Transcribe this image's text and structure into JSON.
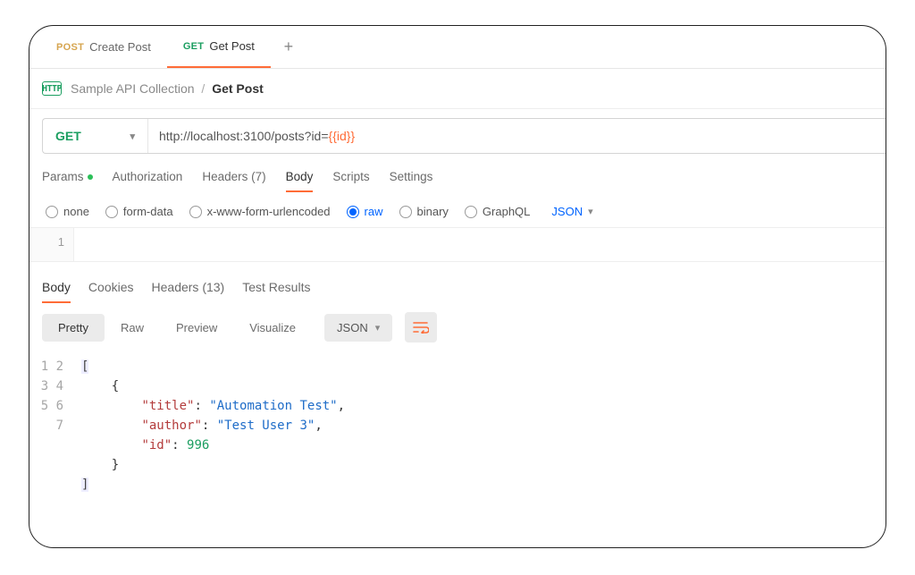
{
  "tabs": [
    {
      "method": "POST",
      "label": "Create Post"
    },
    {
      "method": "GET",
      "label": "Get Post"
    }
  ],
  "active_tab_index": 1,
  "breadcrumb": {
    "collection": "Sample API Collection",
    "current": "Get Post"
  },
  "request": {
    "method": "GET",
    "url_prefix": "http://localhost:3100/posts?id=",
    "url_variable": "{{id}}"
  },
  "request_tabs": {
    "params": "Params",
    "authorization": "Authorization",
    "headers": "Headers (7)",
    "body": "Body",
    "scripts": "Scripts",
    "settings": "Settings"
  },
  "body_types": {
    "none": "none",
    "form_data": "form-data",
    "urlencoded": "x-www-form-urlencoded",
    "raw": "raw",
    "binary": "binary",
    "graphql": "GraphQL"
  },
  "body_format": "JSON",
  "editor_line_1": "1",
  "response_tabs": {
    "body": "Body",
    "cookies": "Cookies",
    "headers": "Headers (13)",
    "test_results": "Test Results"
  },
  "response_viewmodes": {
    "pretty": "Pretty",
    "raw": "Raw",
    "preview": "Preview",
    "visualize": "Visualize"
  },
  "response_format": "JSON",
  "response_body": {
    "gutter": [
      "1",
      "2",
      "3",
      "4",
      "5",
      "6",
      "7"
    ],
    "line1_open": "[",
    "line2_open": "{",
    "kv_title_key": "\"title\"",
    "kv_title_val": "\"Automation Test\"",
    "kv_author_key": "\"author\"",
    "kv_author_val": "\"Test User 3\"",
    "kv_id_key": "\"id\"",
    "kv_id_val": "996",
    "line6_close": "}",
    "line7_close": "]"
  },
  "icons": {
    "http": "HTTP",
    "chevron": "▾",
    "plus": "+",
    "wrap": "⤶"
  }
}
